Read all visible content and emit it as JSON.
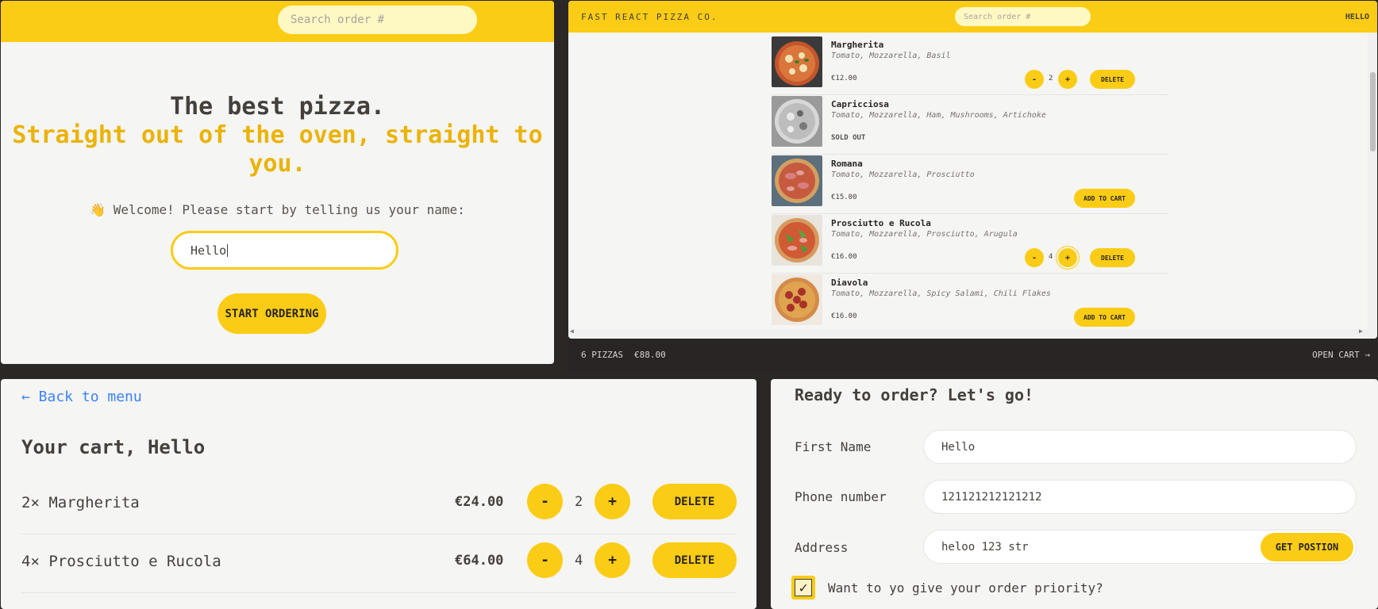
{
  "home": {
    "search_placeholder": "Search order #",
    "title": "The best pizza.",
    "subtitle": "Straight out of the oven, straight to you.",
    "welcome": "👋 Welcome! Please start by telling us your name:",
    "name_value": "Hello",
    "start_button": "START ORDERING"
  },
  "menu_page": {
    "logo": "FAST REACT PIZZA CO.",
    "search_placeholder": "Search order #",
    "username": "HELLO",
    "items": [
      {
        "name": "Margherita",
        "ingredients": "Tomato, Mozzarella, Basil",
        "price": "€12.00",
        "quantity": "2",
        "action": "DELETE",
        "minus": "-",
        "plus": "+"
      },
      {
        "name": "Capricciosa",
        "ingredients": "Tomato, Mozzarella, Ham, Mushrooms, Artichoke",
        "status": "SOLD OUT"
      },
      {
        "name": "Romana",
        "ingredients": "Tomato, Mozzarella, Prosciutto",
        "price": "€15.00",
        "action": "ADD TO CART"
      },
      {
        "name": "Prosciutto e Rucola",
        "ingredients": "Tomato, Mozzarella, Prosciutto, Arugula",
        "price": "€16.00",
        "quantity": "4",
        "action": "DELETE",
        "minus": "-",
        "plus": "+"
      },
      {
        "name": "Diavola",
        "ingredients": "Tomato, Mozzarella, Spicy Salami, Chili Flakes",
        "price": "€16.00",
        "action": "ADD TO CART"
      }
    ],
    "cart_overview": {
      "count": "6 PIZZAS",
      "total": "€88.00",
      "open": "OPEN CART →"
    }
  },
  "cart_page": {
    "back_link": "← Back to menu",
    "title": "Your cart, Hello",
    "items": [
      {
        "name": "2× Margherita",
        "price": "€24.00",
        "quantity": "2",
        "minus": "-",
        "plus": "+",
        "delete": "DELETE"
      },
      {
        "name": "4× Prosciutto e Rucola",
        "price": "€64.00",
        "quantity": "4",
        "minus": "-",
        "plus": "+",
        "delete": "DELETE"
      }
    ]
  },
  "order_form": {
    "title": "Ready to order? Let's go!",
    "first_name_label": "First Name",
    "first_name_value": "Hello",
    "phone_label": "Phone number",
    "phone_value": "121121212121212",
    "address_label": "Address",
    "address_value": "heloo 123 str",
    "get_position": "GET POSTION",
    "priority_label": "Want to yo give your order priority?",
    "priority_checked": true
  },
  "colors": {
    "accent": "#facc15",
    "background": "#f5f5f3",
    "dark": "#292524",
    "link": "#3b82f6"
  }
}
